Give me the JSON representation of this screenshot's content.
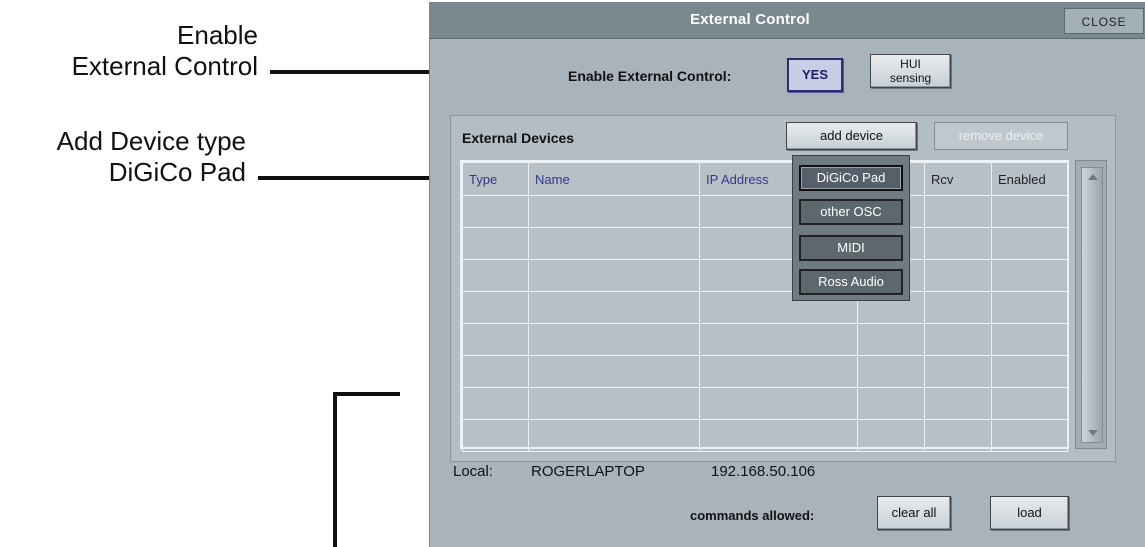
{
  "callouts": {
    "enable_line1": "Enable",
    "enable_line2": "External Control",
    "add_line1": "Add Device type",
    "add_line2": "DiGiCo Pad"
  },
  "window": {
    "title": "External Control",
    "close_label": "CLOSE"
  },
  "enable": {
    "label": "Enable External Control:",
    "yes_label": "YES",
    "hui_line1": "HUI",
    "hui_line2": "sensing"
  },
  "devices": {
    "section_title": "External Devices",
    "add_device_label": "add device",
    "remove_device_label": "remove device",
    "columns": [
      "Type",
      "Name",
      "IP Address",
      "",
      "Rcv",
      "Enabled"
    ],
    "row_count": 8
  },
  "dropdown": {
    "items": [
      "DiGiCo Pad",
      "other OSC",
      "MIDI",
      "Ross Audio"
    ],
    "selected": "DiGiCo Pad"
  },
  "footer": {
    "local_label": "Local:",
    "host_name": "ROGERLAPTOP",
    "ip": "192.168.50.106",
    "commands_label": "commands allowed:",
    "clear_all_label": "clear all",
    "load_label": "load"
  },
  "colors": {
    "window_bg": "#a9b3bb",
    "titlebar_bg": "#7a8890",
    "yes_accent": "#2a2f6a",
    "header_blue": "#333a8a"
  }
}
